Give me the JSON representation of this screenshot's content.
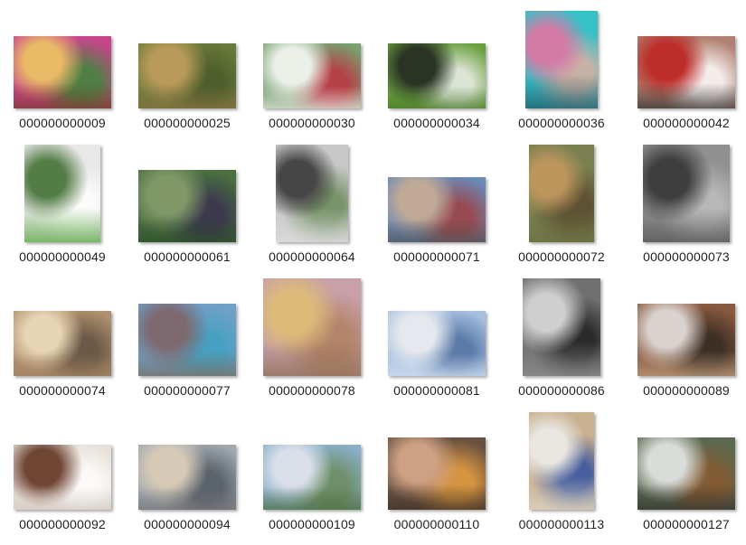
{
  "files": [
    {
      "name": "000000000009",
      "w": 108,
      "h": 80,
      "bg": "#c8458a",
      "c1": "#f0d060",
      "c2": "#3a8a3a",
      "c3": "#7a3a2a"
    },
    {
      "name": "000000000025",
      "w": 108,
      "h": 72,
      "bg": "#6a7a3a",
      "c1": "#c8a060",
      "c2": "#4a5a2a",
      "c3": "#8a7040"
    },
    {
      "name": "000000000030",
      "w": 108,
      "h": 72,
      "bg": "#7aa070",
      "c1": "#ffffff",
      "c2": "#c03040",
      "c3": "#e8e8e0"
    },
    {
      "name": "000000000034",
      "w": 108,
      "h": 72,
      "bg": "#6aa040",
      "c1": "#202020",
      "c2": "#f0f0f0",
      "c3": "#4a7a2a"
    },
    {
      "name": "000000000036",
      "w": 80,
      "h": 108,
      "bg": "#38c0c8",
      "c1": "#f070a0",
      "c2": "#e0b0a0",
      "c3": "#205060"
    },
    {
      "name": "000000000042",
      "w": 108,
      "h": 80,
      "bg": "#b08070",
      "c1": "#c02020",
      "c2": "#ffffff",
      "c3": "#303030"
    },
    {
      "name": "000000000049",
      "w": 84,
      "h": 108,
      "bg": "#e8e8e8",
      "c1": "#3a6a2a",
      "c2": "#ffffff",
      "c3": "#4aa030"
    },
    {
      "name": "000000000061",
      "w": 108,
      "h": 80,
      "bg": "#4a7040",
      "c1": "#8aa070",
      "c2": "#3a3050",
      "c3": "#2a4a2a"
    },
    {
      "name": "000000000064",
      "w": 80,
      "h": 108,
      "bg": "#c8c8c8",
      "c1": "#303030",
      "c2": "#6a8a5a",
      "c3": "#e0e0e0"
    },
    {
      "name": "000000000071",
      "w": 108,
      "h": 72,
      "bg": "#6a8ab8",
      "c1": "#d0b090",
      "c2": "#a04040",
      "c3": "#505050"
    },
    {
      "name": "000000000072",
      "w": 72,
      "h": 108,
      "bg": "#7a8050",
      "c1": "#c89a60",
      "c2": "#5a4a30",
      "c3": "#6a7040"
    },
    {
      "name": "000000000073",
      "w": 96,
      "h": 108,
      "bg": "#909090",
      "c1": "#303030",
      "c2": "#c0c0c0",
      "c3": "#505050"
    },
    {
      "name": "000000000074",
      "w": 108,
      "h": 72,
      "bg": "#b09070",
      "c1": "#f0e0c0",
      "c2": "#605040",
      "c3": "#a08060"
    },
    {
      "name": "000000000077",
      "w": 108,
      "h": 80,
      "bg": "#70a0c8",
      "c1": "#806060",
      "c2": "#40a0c0",
      "c3": "#7a6a5a"
    },
    {
      "name": "000000000078",
      "w": 108,
      "h": 108,
      "bg": "#c8a0a8",
      "c1": "#e0c070",
      "c2": "#b08060",
      "c3": "#8a6a50"
    },
    {
      "name": "000000000081",
      "w": 108,
      "h": 72,
      "bg": "#a8c0e0",
      "c1": "#f0f0f0",
      "c2": "#5070a0",
      "c3": "#d0e0f0"
    },
    {
      "name": "000000000086",
      "w": 86,
      "h": 108,
      "bg": "#707070",
      "c1": "#e0e0e0",
      "c2": "#202020",
      "c3": "#909090"
    },
    {
      "name": "000000000089",
      "w": 108,
      "h": 80,
      "bg": "#8a5a40",
      "c1": "#e8e8e8",
      "c2": "#302820",
      "c3": "#c0a080"
    },
    {
      "name": "000000000092",
      "w": 108,
      "h": 72,
      "bg": "#e8e0d8",
      "c1": "#5a2a18",
      "c2": "#ffffff",
      "c3": "#d0c8c0"
    },
    {
      "name": "000000000094",
      "w": 108,
      "h": 72,
      "bg": "#a0a8b0",
      "c1": "#e0d0b8",
      "c2": "#505860",
      "c3": "#707070"
    },
    {
      "name": "000000000109",
      "w": 108,
      "h": 72,
      "bg": "#8ab0c8",
      "c1": "#e8e8f0",
      "c2": "#6a8a5a",
      "c3": "#4a6a3a"
    },
    {
      "name": "000000000110",
      "w": 108,
      "h": 80,
      "bg": "#6a5040",
      "c1": "#e0b090",
      "c2": "#e8a040",
      "c3": "#3a3028"
    },
    {
      "name": "000000000113",
      "w": 72,
      "h": 108,
      "bg": "#c8b090",
      "c1": "#f0f0f0",
      "c2": "#3050a0",
      "c3": "#e0d8c8"
    },
    {
      "name": "000000000127",
      "w": 108,
      "h": 80,
      "bg": "#5a6a50",
      "c1": "#f0f0f0",
      "c2": "#8a5a30",
      "c3": "#303030"
    }
  ]
}
